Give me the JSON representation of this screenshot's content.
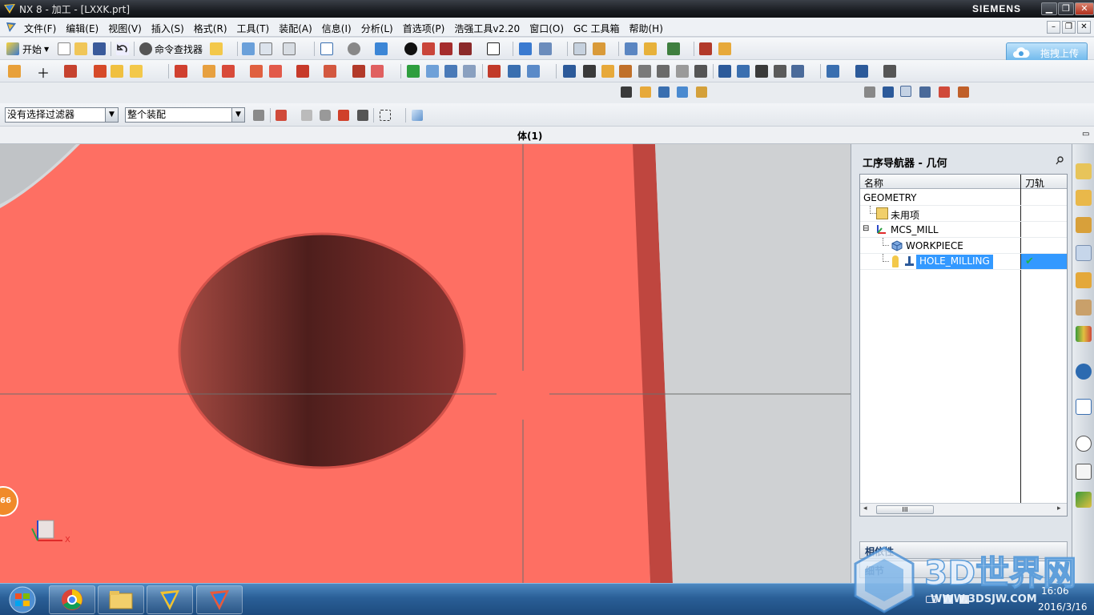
{
  "titlebar": {
    "title": "NX 8 - 加工 - [LXXK.prt]",
    "brand": "SIEMENS",
    "min": "▁",
    "restore": "❐",
    "close": "✕"
  },
  "menubar": {
    "items": [
      "文件(F)",
      "编辑(E)",
      "视图(V)",
      "插入(S)",
      "格式(R)",
      "工具(T)",
      "装配(A)",
      "信息(I)",
      "分析(L)",
      "首选项(P)",
      "浩强工具v2.20",
      "窗口(O)",
      "GC 工具箱",
      "帮助(H)"
    ],
    "mdi": [
      "–",
      "❐",
      "✕"
    ]
  },
  "toolbar": {
    "start_label": "开始",
    "command_finder_label": "命令查找器",
    "upload_label": "拖拽上传"
  },
  "selection_bar": {
    "filter_value": "没有选择过滤器",
    "scope_value": "整个装配"
  },
  "cue": {
    "status": "体(1)"
  },
  "viewport": {
    "badge_text": "66",
    "axis_x_label": "X"
  },
  "navigator": {
    "title": "工序导航器 - 几何",
    "col_name": "名称",
    "col_path": "刀轨",
    "rows": [
      {
        "name": "GEOMETRY"
      },
      {
        "name": "未用项"
      },
      {
        "name": "MCS_MILL",
        "expander": "⊟"
      },
      {
        "name": "WORKPIECE"
      },
      {
        "name": "HOLE_MILLING",
        "status": "✔"
      }
    ],
    "scroll_thumb": "III",
    "scroll_left": "◂",
    "scroll_right": "▸",
    "dependencies_label": "相依性",
    "details_label": "细节"
  },
  "taskbar": {
    "time": "16:06",
    "date": "2016/3/16"
  },
  "watermark": {
    "text": "3D世界网",
    "url": "WWW.3DSJW.COM"
  },
  "colors": {
    "part": "#fe6f63",
    "hole_dark": "#5a2320",
    "selection": "#3399ff",
    "taskbar": "#2a5f97"
  }
}
